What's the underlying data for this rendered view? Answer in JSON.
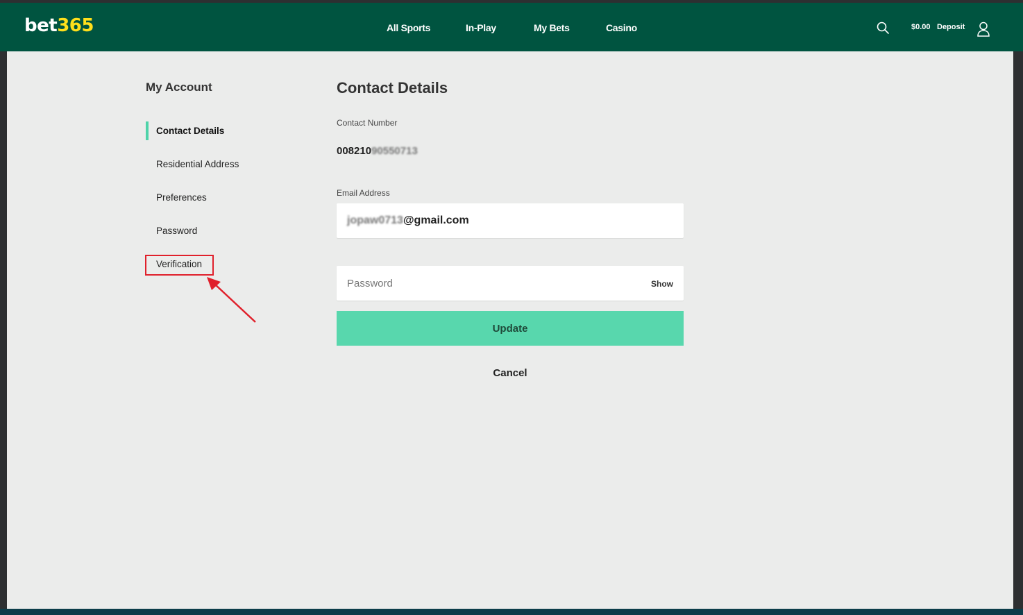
{
  "header": {
    "logo_part1": "bet",
    "logo_part2": "365",
    "nav": [
      "All Sports",
      "In-Play",
      "My Bets",
      "Casino"
    ],
    "balance": "$0.00",
    "deposit_label": "Deposit",
    "icons": [
      "search-icon",
      "user-icon"
    ]
  },
  "sidebar": {
    "title": "My Account",
    "items": [
      {
        "label": "Contact Details",
        "active": true
      },
      {
        "label": "Residential Address",
        "active": false
      },
      {
        "label": "Preferences",
        "active": false
      },
      {
        "label": "Password",
        "active": false
      },
      {
        "label": "Verification",
        "active": false
      }
    ]
  },
  "main": {
    "title": "Contact Details",
    "contact_number_label": "Contact Number",
    "contact_number_visible": "008210",
    "contact_number_obscured": "90550713",
    "email_label": "Email Address",
    "email_obscured": "jopaw0713",
    "email_domain": "@gmail.com",
    "password_placeholder": "Password",
    "show_label": "Show",
    "update_label": "Update",
    "cancel_label": "Cancel"
  },
  "colors": {
    "header_bg": "#005440",
    "logo_accent": "#ffdf1b",
    "active_indicator": "#4ed3a9",
    "update_button": "#58d7ad",
    "annotation_red": "#e0202b"
  }
}
